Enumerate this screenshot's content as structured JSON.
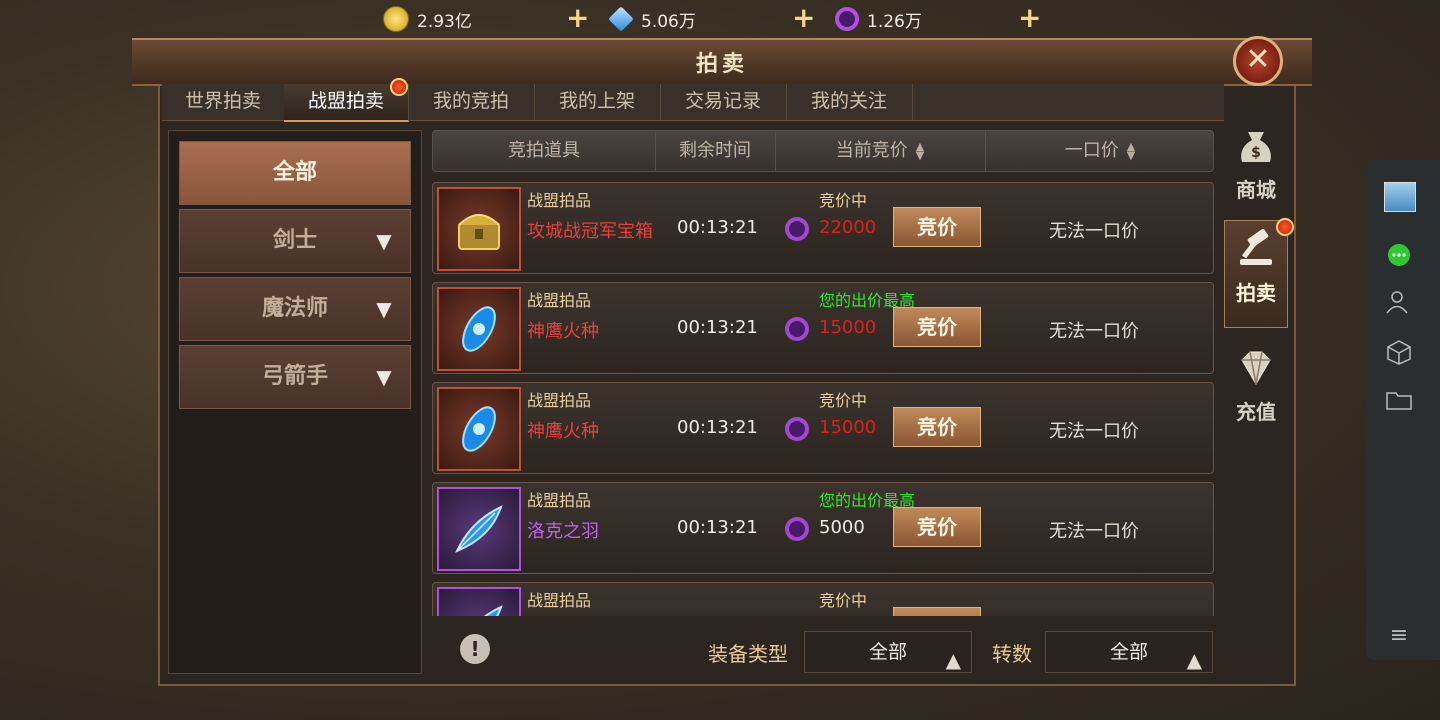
{
  "currencies": [
    {
      "icon": "gold-coin-icon",
      "value": "2.93亿"
    },
    {
      "icon": "blue-diamond-icon",
      "value": "5.06万"
    },
    {
      "icon": "purple-gem-icon",
      "value": "1.26万"
    }
  ],
  "window": {
    "title": "拍卖"
  },
  "tabs": [
    {
      "label": "世界拍卖"
    },
    {
      "label": "战盟拍卖"
    },
    {
      "label": "我的竞拍"
    },
    {
      "label": "我的上架"
    },
    {
      "label": "交易记录"
    },
    {
      "label": "我的关注"
    }
  ],
  "categories": [
    {
      "label": "全部"
    },
    {
      "label": "剑士"
    },
    {
      "label": "魔法师"
    },
    {
      "label": "弓箭手"
    }
  ],
  "table": {
    "headers": {
      "item": "竞拍道具",
      "time": "剩余时间",
      "current_bid": "当前竞价",
      "buyout": "一口价"
    },
    "bid_button": "竞价",
    "rows": [
      {
        "category": "战盟拍品",
        "name": "攻城战冠军宝箱",
        "name_color": "#e8413a",
        "time": "00:13:21",
        "status": "竞价中",
        "status_color": "#e8d0a0",
        "bid": "22000",
        "bid_color": "#e0201a",
        "buyout": "无法一口价",
        "quality": "red",
        "icon": "treasure-chest-icon"
      },
      {
        "category": "战盟拍品",
        "name": "神鹰火种",
        "name_color": "#e8413a",
        "time": "00:13:21",
        "status": "您的出价最高",
        "status_color": "#2ee82e",
        "bid": "15000",
        "bid_color": "#e0201a",
        "buyout": "无法一口价",
        "quality": "red",
        "icon": "blue-crystal-icon"
      },
      {
        "category": "战盟拍品",
        "name": "神鹰火种",
        "name_color": "#e8413a",
        "time": "00:13:21",
        "status": "竞价中",
        "status_color": "#e8d0a0",
        "bid": "15000",
        "bid_color": "#e0201a",
        "buyout": "无法一口价",
        "quality": "red",
        "icon": "blue-crystal-icon"
      },
      {
        "category": "战盟拍品",
        "name": "洛克之羽",
        "name_color": "#c060f0",
        "time": "00:13:21",
        "status": "您的出价最高",
        "status_color": "#2ee82e",
        "bid": "5000",
        "bid_color": "#f0ece6",
        "buyout": "无法一口价",
        "quality": "purple",
        "icon": "blue-feather-icon"
      },
      {
        "category": "战盟拍品",
        "name": "",
        "name_color": "#c060f0",
        "time": "",
        "status": "竞价中",
        "status_color": "#e8d0a0",
        "bid": "",
        "bid_color": "#f0ece6",
        "buyout": "",
        "quality": "purple",
        "icon": "blue-feather-icon"
      }
    ]
  },
  "filters": {
    "equip_type_label": "装备类型",
    "equip_type_value": "全部",
    "rebirth_label": "转数",
    "rebirth_value": "全部"
  },
  "sidenav": [
    {
      "label": "商城",
      "icon": "money-bag-icon"
    },
    {
      "label": "拍卖",
      "icon": "gavel-icon"
    },
    {
      "label": "充值",
      "icon": "diamond-icon"
    }
  ]
}
